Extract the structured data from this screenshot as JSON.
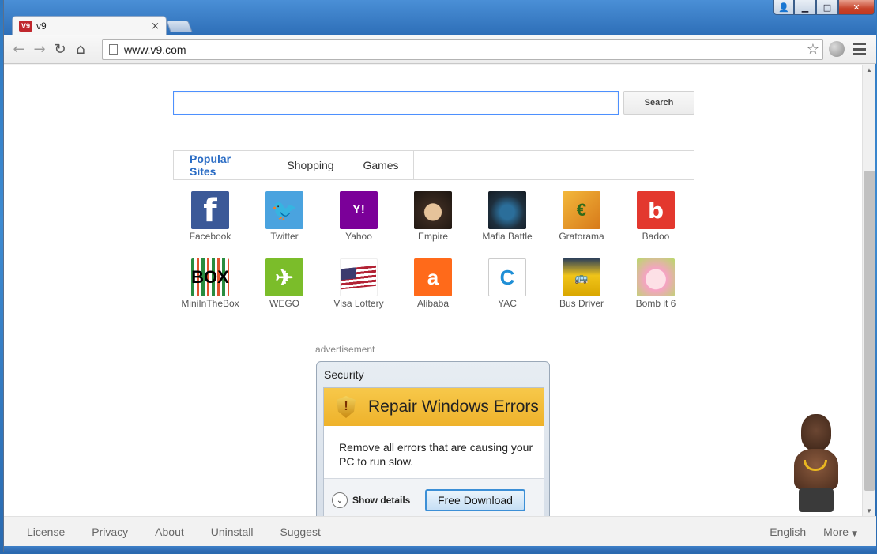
{
  "browser": {
    "tab_title": "v9",
    "tab_favicon_text": "V9",
    "tab_close": "×",
    "url": "www.v9.com",
    "window_controls": {
      "user": "👤",
      "minimize": "▁",
      "maximize": "□",
      "close": "✕"
    }
  },
  "search": {
    "placeholder": "",
    "button_label": "Search"
  },
  "tabs": [
    {
      "label": "Popular Sites",
      "active": true
    },
    {
      "label": "Shopping",
      "active": false
    },
    {
      "label": "Games",
      "active": false
    }
  ],
  "sites": [
    {
      "label": "Facebook",
      "icon": "facebook-icon",
      "glyph": "f"
    },
    {
      "label": "Twitter",
      "icon": "twitter-icon",
      "glyph": "🐦"
    },
    {
      "label": "Yahoo",
      "icon": "yahoo-icon",
      "glyph": "Y!"
    },
    {
      "label": "Empire",
      "icon": "empire-icon",
      "glyph": ""
    },
    {
      "label": "Mafia Battle",
      "icon": "mafia-battle-icon",
      "glyph": ""
    },
    {
      "label": "Gratorama",
      "icon": "gratorama-icon",
      "glyph": "€"
    },
    {
      "label": "Badoo",
      "icon": "badoo-icon",
      "glyph": "b"
    },
    {
      "label": "MiniInTheBox",
      "icon": "miniinthebox-icon",
      "glyph": "BOX"
    },
    {
      "label": "WEGO",
      "icon": "wego-icon",
      "glyph": "✈"
    },
    {
      "label": "Visa Lottery",
      "icon": "flag-icon",
      "glyph": ""
    },
    {
      "label": "Alibaba",
      "icon": "alibaba-icon",
      "glyph": "a"
    },
    {
      "label": "YAC",
      "icon": "yac-icon",
      "glyph": "C"
    },
    {
      "label": "Bus Driver",
      "icon": "bus-icon",
      "glyph": "🚌"
    },
    {
      "label": "Bomb it 6",
      "icon": "bomb-it-icon",
      "glyph": ""
    }
  ],
  "advertisement": {
    "label": "advertisement",
    "window_title": "Security",
    "headline": "Repair Windows Errors",
    "body": "Remove all errors that are causing your PC to run slow.",
    "show_details": "Show details",
    "download_button": "Free Download"
  },
  "footer": {
    "links": [
      "License",
      "Privacy",
      "About",
      "Uninstall",
      "Suggest"
    ],
    "language": "English",
    "more": "More"
  }
}
